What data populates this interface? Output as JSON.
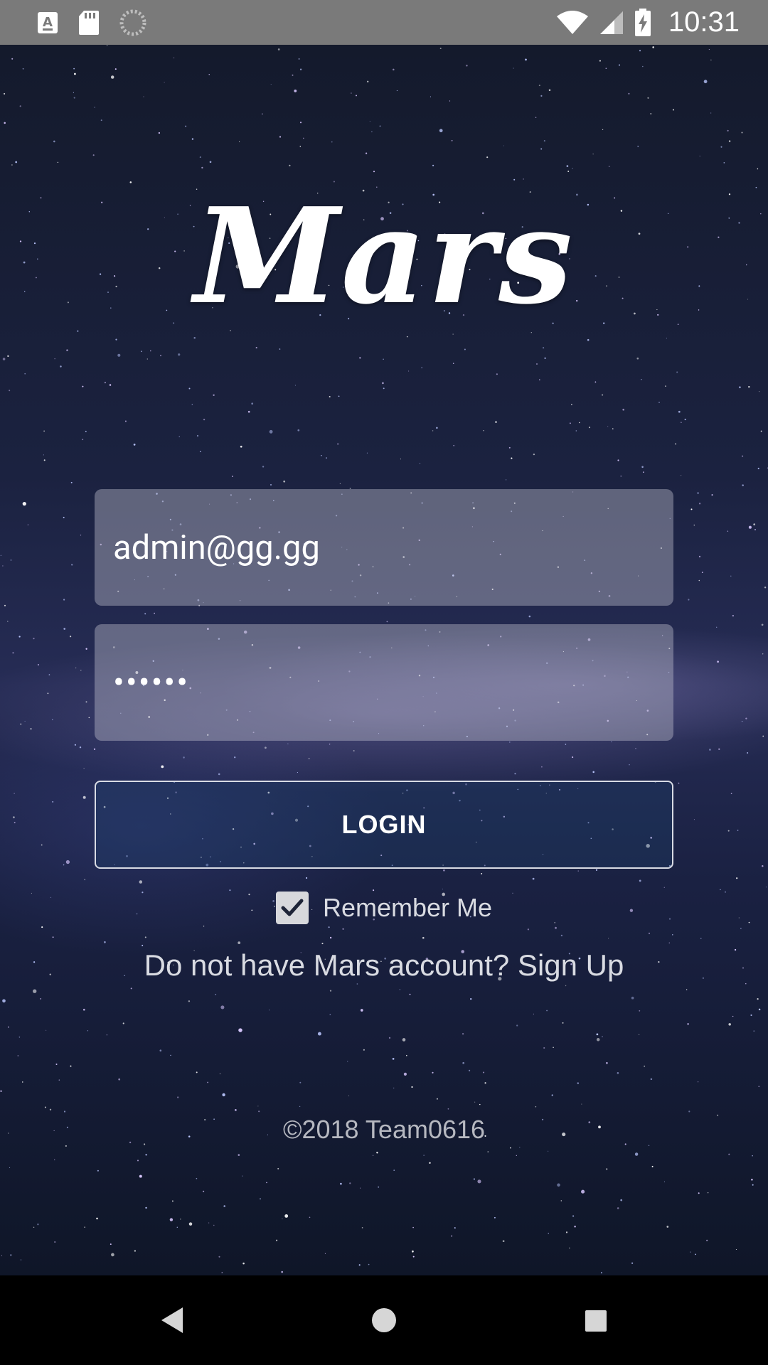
{
  "status_bar": {
    "time": "10:31",
    "icons": [
      "keyboard-icon",
      "sd-card-icon",
      "sync-icon",
      "wifi-icon",
      "signal-icon",
      "battery-charging-icon"
    ]
  },
  "app": {
    "logo_text": "Mars"
  },
  "login_form": {
    "email_value": "admin@gg.gg",
    "password_value": "••••••",
    "login_label": "LOGIN",
    "remember_label": "Remember Me",
    "remember_checked": true,
    "signup_text": "Do not have Mars account? Sign Up"
  },
  "footer": {
    "copyright": "©2018 Team0616"
  },
  "nav_bar": {
    "buttons": [
      "back-icon",
      "home-icon",
      "recents-icon"
    ]
  },
  "colors": {
    "status_bar": "#7a7a7a",
    "field_bg": "rgba(190,190,205,0.42)",
    "text_light": "#d9dbe2",
    "nav_bar": "#000000"
  }
}
